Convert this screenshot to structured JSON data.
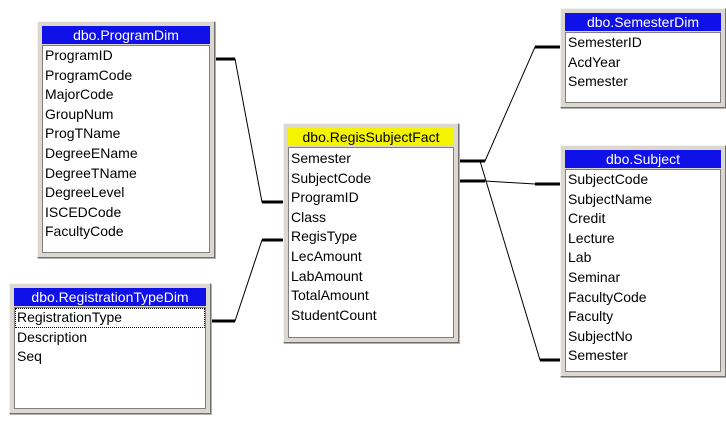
{
  "tables": {
    "program_dim": {
      "title": "dbo.ProgramDim",
      "columns": [
        "ProgramID",
        "ProgramCode",
        "MajorCode",
        "GroupNum",
        "ProgTName",
        "DegreeEName",
        "DegreeTName",
        "DegreeLevel",
        "ISCEDCode",
        "FacultyCode"
      ]
    },
    "registration_type_dim": {
      "title": "dbo.RegistrationTypeDim",
      "columns": [
        "RegistrationType",
        "Description",
        "Seq"
      ]
    },
    "regis_subject_fact": {
      "title": "dbo.RegisSubjectFact",
      "columns": [
        "Semester",
        "SubjectCode",
        "ProgramID",
        "Class",
        "RegisType",
        "LecAmount",
        "LabAmount",
        "TotalAmount",
        "StudentCount"
      ]
    },
    "semester_dim": {
      "title": "dbo.SemesterDim",
      "columns": [
        "SemesterID",
        "AcdYear",
        "Semester"
      ]
    },
    "subject": {
      "title": "dbo.Subject",
      "columns": [
        "SubjectCode",
        "SubjectName",
        "Credit",
        "Lecture",
        "Lab",
        "Seminar",
        "FacultyCode",
        "Faculty",
        "SubjectNo",
        "Semester"
      ]
    }
  }
}
